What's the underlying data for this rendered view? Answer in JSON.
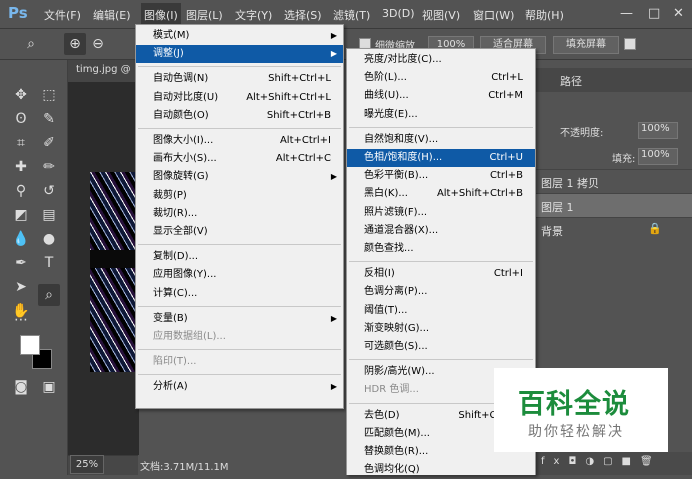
{
  "app_logo": "Ps",
  "menubar": [
    "文件(F)",
    "编辑(E)",
    "图像(I)",
    "图层(L)",
    "文字(Y)",
    "选择(S)",
    "滤镜(T)",
    "3D(D)",
    "视图(V)",
    "窗口(W)",
    "帮助(H)"
  ],
  "window_controls": [
    "—",
    "□",
    "✕"
  ],
  "options": {
    "scrubby_zoom": "细微缩放",
    "zoom_pct": "100%",
    "fit_screen": "适合屏幕",
    "fill_screen": "填充屏幕"
  },
  "doc_tab": "timg.jpg @",
  "status": {
    "zoom": "25%",
    "doc": "文档:3.71M/11.1M"
  },
  "panel": {
    "tab_paths": "路径",
    "opacity_label": "不透明度:",
    "opacity_value": "100%",
    "fill_label": "填充:",
    "fill_value": "100%"
  },
  "layers": [
    "图层 1 拷贝",
    "图层 1",
    "背景"
  ],
  "image_menu": [
    {
      "label": "模式(M)",
      "arrow": true
    },
    {
      "label": "调整(J)",
      "arrow": true,
      "highlight": true
    },
    {
      "sep": true
    },
    {
      "label": "自动色调(N)",
      "shortcut": "Shift+Ctrl+L"
    },
    {
      "label": "自动对比度(U)",
      "shortcut": "Alt+Shift+Ctrl+L"
    },
    {
      "label": "自动颜色(O)",
      "shortcut": "Shift+Ctrl+B"
    },
    {
      "sep": true
    },
    {
      "label": "图像大小(I)...",
      "shortcut": "Alt+Ctrl+I"
    },
    {
      "label": "画布大小(S)...",
      "shortcut": "Alt+Ctrl+C"
    },
    {
      "label": "图像旋转(G)",
      "arrow": true
    },
    {
      "label": "裁剪(P)"
    },
    {
      "label": "裁切(R)..."
    },
    {
      "label": "显示全部(V)"
    },
    {
      "sep": true
    },
    {
      "label": "复制(D)..."
    },
    {
      "label": "应用图像(Y)..."
    },
    {
      "label": "计算(C)..."
    },
    {
      "sep": true
    },
    {
      "label": "变量(B)",
      "arrow": true
    },
    {
      "label": "应用数据组(L)...",
      "disabled": true
    },
    {
      "sep": true
    },
    {
      "label": "陷印(T)...",
      "disabled": true
    },
    {
      "sep": true
    },
    {
      "label": "分析(A)",
      "arrow": true
    }
  ],
  "adjust_menu": [
    {
      "label": "亮度/对比度(C)..."
    },
    {
      "label": "色阶(L)...",
      "shortcut": "Ctrl+L"
    },
    {
      "label": "曲线(U)...",
      "shortcut": "Ctrl+M"
    },
    {
      "label": "曝光度(E)..."
    },
    {
      "sep": true
    },
    {
      "label": "自然饱和度(V)..."
    },
    {
      "label": "色相/饱和度(H)...",
      "shortcut": "Ctrl+U",
      "highlight": true
    },
    {
      "label": "色彩平衡(B)...",
      "shortcut": "Ctrl+B"
    },
    {
      "label": "黑白(K)...",
      "shortcut": "Alt+Shift+Ctrl+B"
    },
    {
      "label": "照片滤镜(F)..."
    },
    {
      "label": "通道混合器(X)..."
    },
    {
      "label": "颜色查找..."
    },
    {
      "sep": true
    },
    {
      "label": "反相(I)",
      "shortcut": "Ctrl+I"
    },
    {
      "label": "色调分离(P)..."
    },
    {
      "label": "阈值(T)..."
    },
    {
      "label": "渐变映射(G)..."
    },
    {
      "label": "可选颜色(S)..."
    },
    {
      "sep": true
    },
    {
      "label": "阴影/高光(W)..."
    },
    {
      "label": "HDR 色调...",
      "disabled": true
    },
    {
      "sep": true
    },
    {
      "label": "去色(D)",
      "shortcut": "Shift+Ctrl+U"
    },
    {
      "label": "匹配颜色(M)..."
    },
    {
      "label": "替换颜色(R)..."
    },
    {
      "label": "色调均化(Q)"
    }
  ],
  "watermark": {
    "title": "百科全说",
    "subtitle": "助你轻松解决"
  }
}
